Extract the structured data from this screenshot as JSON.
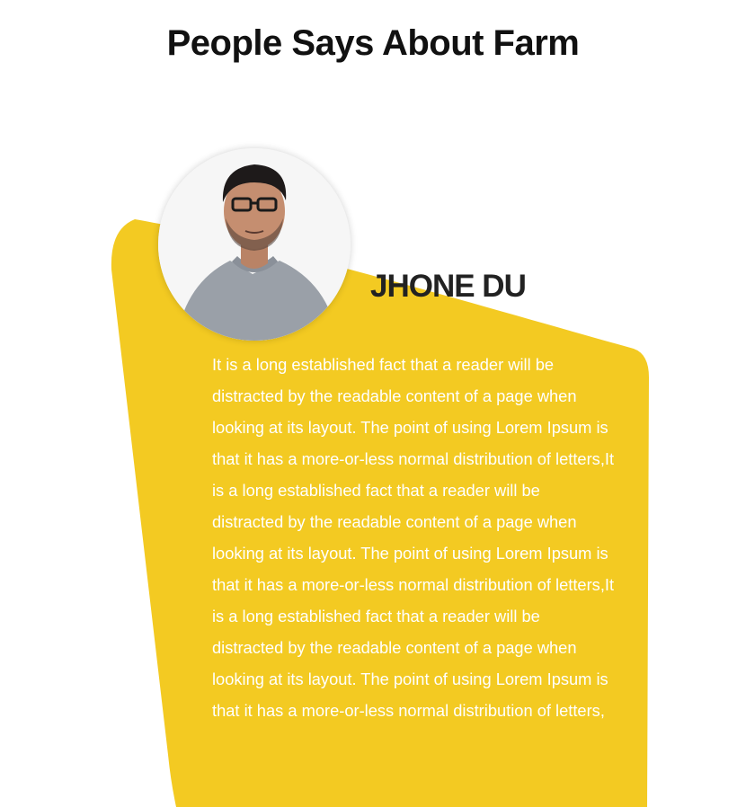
{
  "section": {
    "title": "People Says About Farm"
  },
  "testimonial": {
    "name": "JHONE DU",
    "text": "It is a long established fact that a reader will be distracted by the readable content of a page when looking at its layout. The point of using Lorem Ipsum is that it has a more-or-less normal distribution of letters,It is a long established fact that a reader will be distracted by the readable content of a page when looking at its layout. The point of using Lorem Ipsum is that it has a more-or-less normal distribution of letters,It is a long established fact that a reader will be distracted by the readable content of a page when looking at its layout. The point of using Lorem Ipsum is that it has a more-or-less normal distribution of letters,",
    "avatar_icon": "person-photo-icon"
  },
  "colors": {
    "card_background": "#F3CA22",
    "title_text": "#111111",
    "name_text": "#222222",
    "quote_text": "#FFFFFF"
  }
}
